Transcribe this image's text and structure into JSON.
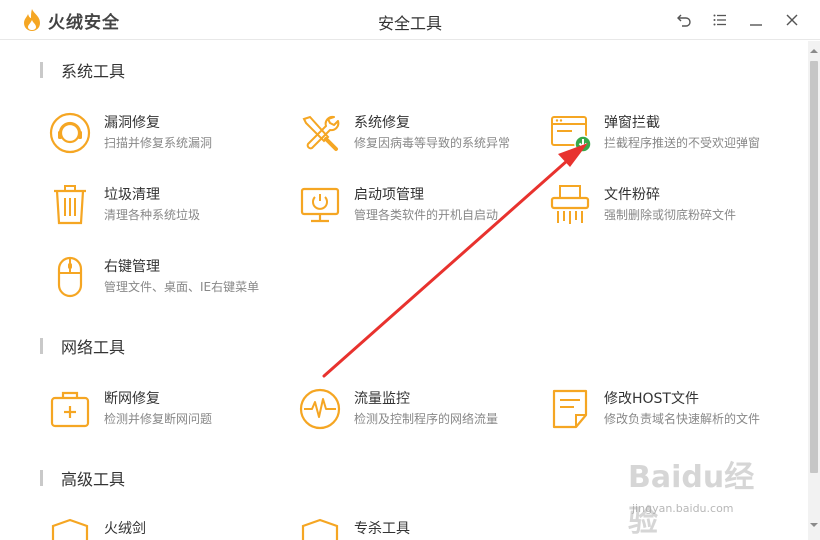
{
  "app": {
    "name": "火绒安全",
    "window_title": "安全工具"
  },
  "colors": {
    "accent": "#F5A623",
    "arrow": "#E8322E",
    "badge": "#37A84A"
  },
  "sections": [
    {
      "label": "系统工具"
    },
    {
      "label": "网络工具"
    },
    {
      "label": "高级工具"
    }
  ],
  "tools": {
    "vuln": {
      "name": "漏洞修复",
      "desc": "扫描并修复系统漏洞",
      "icon": "lifebuoy-icon"
    },
    "sysrepair": {
      "name": "系统修复",
      "desc": "修复因病毒等导致的系统异常",
      "icon": "tools-icon"
    },
    "popup": {
      "name": "弹窗拦截",
      "desc": "拦截程序推送的不受欢迎弹窗",
      "icon": "popup-window-icon"
    },
    "junk": {
      "name": "垃圾清理",
      "desc": "清理各种系统垃圾",
      "icon": "trash-icon"
    },
    "startup": {
      "name": "启动项管理",
      "desc": "管理各类软件的开机自启动",
      "icon": "monitor-icon"
    },
    "shred": {
      "name": "文件粉碎",
      "desc": "强制删除或彻底粉碎文件",
      "icon": "shredder-icon"
    },
    "rightclick": {
      "name": "右键管理",
      "desc": "管理文件、桌面、IE右键菜单",
      "icon": "mouse-icon"
    },
    "netrepair": {
      "name": "断网修复",
      "desc": "检测并修复断网问题",
      "icon": "first-aid-kit-icon"
    },
    "traffic": {
      "name": "流量监控",
      "desc": "检测及控制程序的网络流量",
      "icon": "pulse-icon"
    },
    "host": {
      "name": "修改HOST文件",
      "desc": "修改负责域名快速解析的文件",
      "icon": "document-icon"
    },
    "sword": {
      "name": "火绒剑",
      "icon": "shield-icon"
    },
    "special": {
      "name": "专杀工具",
      "icon": "shield-icon"
    }
  },
  "watermark": {
    "mark": "Baidu经验",
    "url": "jingyan.baidu.com"
  }
}
